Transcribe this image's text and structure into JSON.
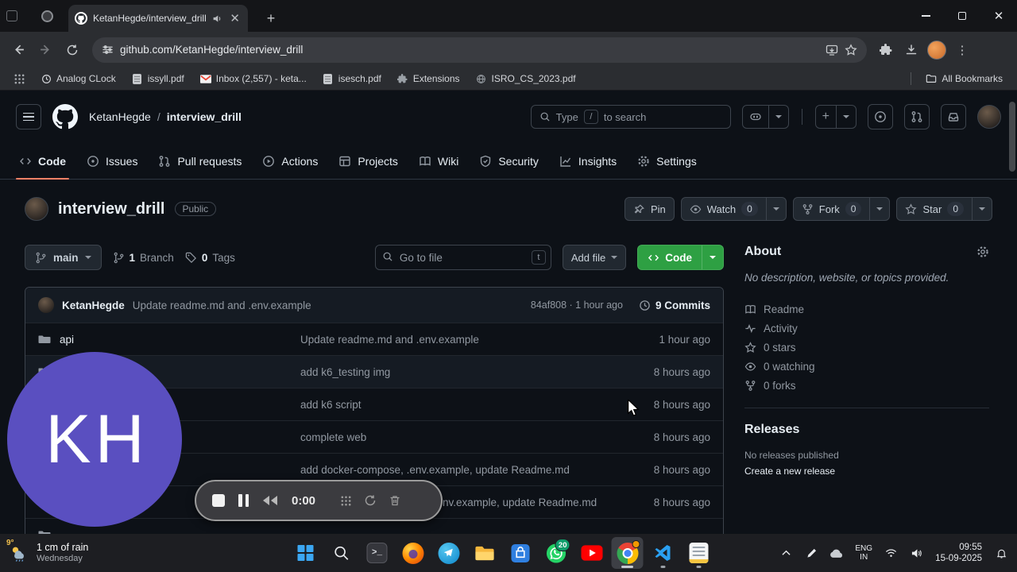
{
  "colors": {
    "accent_green": "#2ea043",
    "link_blue": "#4493f8",
    "overlay_purple": "#5a4fc0",
    "tab_underline": "#f78166"
  },
  "browser": {
    "tab_title": "KetanHegde/interview_drill",
    "url": "github.com/KetanHegde/interview_drill",
    "bookmarks": [
      "Analog CLock",
      "issyll.pdf",
      "Inbox (2,557) - keta...",
      "isesch.pdf",
      "Extensions",
      "ISRO_CS_2023.pdf"
    ],
    "all_bookmarks": "All Bookmarks"
  },
  "github": {
    "header": {
      "owner": "KetanHegde",
      "repo": "interview_drill",
      "search_pre": "Type",
      "search_key": "/",
      "search_post": "to search"
    },
    "nav": [
      "Code",
      "Issues",
      "Pull requests",
      "Actions",
      "Projects",
      "Wiki",
      "Security",
      "Insights",
      "Settings"
    ],
    "repo": {
      "title": "interview_drill",
      "visibility": "Public",
      "pin_label": "Pin",
      "watch_label": "Watch",
      "watch_count": "0",
      "fork_label": "Fork",
      "fork_count": "0",
      "star_label": "Star",
      "star_count": "0"
    },
    "controls": {
      "branch": "main",
      "branch_count": "1",
      "branch_label": "Branch",
      "tag_count": "0",
      "tag_label": "Tags",
      "goto_placeholder": "Go to file",
      "goto_key": "t",
      "add_file_label": "Add file",
      "code_label": "Code"
    },
    "commit_bar": {
      "author": "KetanHegde",
      "message": "Update readme.md and .env.example",
      "meta": "84af808 · 1 hour ago",
      "commits": "9 Commits"
    },
    "files": [
      {
        "name": "api",
        "message": "Update readme.md and .env.example",
        "time": "1 hour ago"
      },
      {
        "name": "",
        "message": "add k6_testing img",
        "time": "8 hours ago"
      },
      {
        "name": "",
        "message": "add k6 script",
        "time": "8 hours ago"
      },
      {
        "name": "",
        "message": "complete web",
        "time": "8 hours ago"
      },
      {
        "name": "",
        "message": "add docker-compose, .env.example, update Readme.md",
        "time": "8 hours ago"
      },
      {
        "name": "",
        "message": "nv.example, update Readme.md",
        "time": "8 hours ago"
      }
    ],
    "about": {
      "title": "About",
      "description": "No description, website, or topics provided.",
      "items": [
        "Readme",
        "Activity",
        "0 stars",
        "0 watching",
        "0 forks"
      ],
      "releases_title": "Releases",
      "releases_empty": "No releases published",
      "releases_link": "Create a new release"
    }
  },
  "overlay": {
    "initials": "KH",
    "timer": "0:00"
  },
  "taskbar": {
    "temp": "9°",
    "weather_line1": "1 cm of rain",
    "weather_line2": "Wednesday",
    "whatsapp_badge": "20",
    "lang_top": "ENG",
    "lang_bottom": "IN",
    "time": "09:55",
    "date": "15-09-2025"
  }
}
